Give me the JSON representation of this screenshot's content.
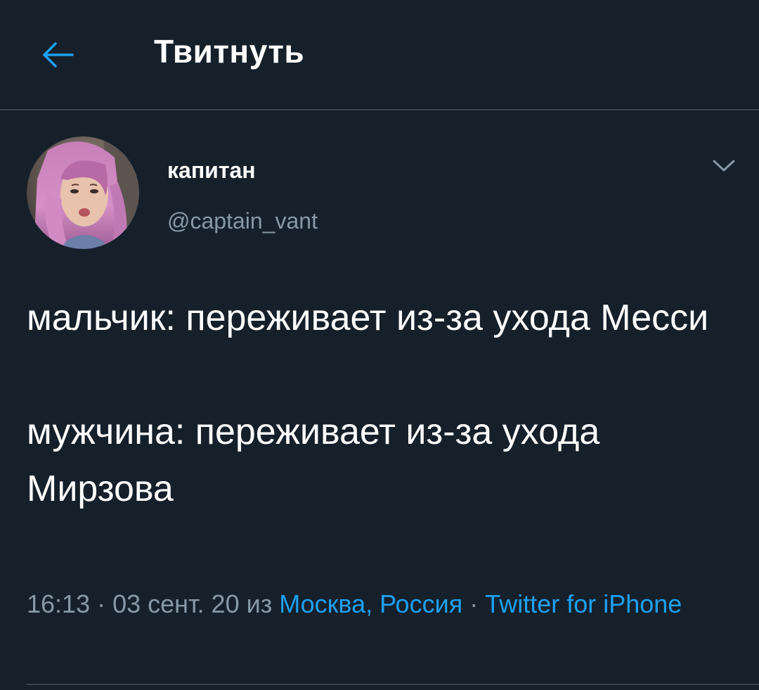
{
  "header": {
    "back_icon": "arrow-left-icon",
    "title": "Твитнуть"
  },
  "colors": {
    "background": "#15202b",
    "accent": "#1da1f2",
    "secondary_text": "#8899a6",
    "divider": "#38444d"
  },
  "author": {
    "display_name": "капитан",
    "handle": "@captain_vant",
    "avatar_icon": "user-avatar",
    "more_icon": "chevron-down-icon"
  },
  "tweet": {
    "paragraphs": [
      "мальчик: переживает из-за ухода Месси",
      "мужчина: переживает из-за ухода Мирзова"
    ]
  },
  "meta": {
    "time": "16:13",
    "separator": " · ",
    "date": "03 сент. 20",
    "from_word": " из ",
    "location": "Москва, Россия",
    "source": "Twitter for iPhone"
  }
}
